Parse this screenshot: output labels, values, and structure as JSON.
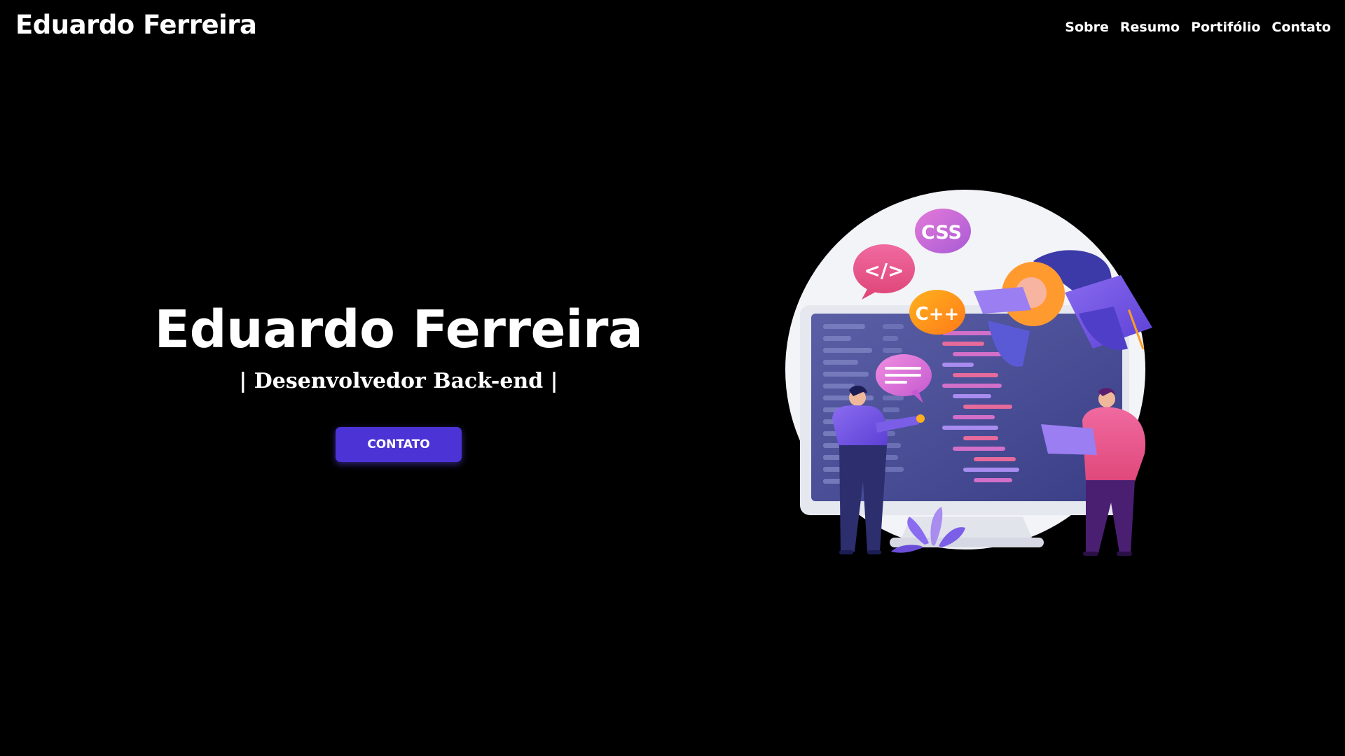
{
  "header": {
    "brand": "Eduardo Ferreira",
    "nav": [
      {
        "label": "Sobre"
      },
      {
        "label": "Resumo"
      },
      {
        "label": "Portifólio"
      },
      {
        "label": "Contato"
      }
    ]
  },
  "hero": {
    "title": "Eduardo Ferreira",
    "subtitle": "| Desenvolvedor Back-end |",
    "cta_label": "CONTATO"
  },
  "illustration": {
    "bubble_code": "</>",
    "bubble_css": "CSS",
    "bubble_cpp": "C++",
    "icon": "developers-illustration"
  },
  "colors": {
    "background": "#000000",
    "accent": "#4b33d6",
    "text": "#ffffff"
  }
}
